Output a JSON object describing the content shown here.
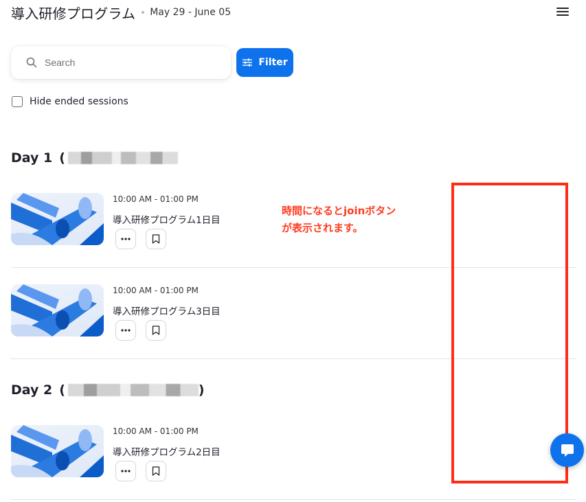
{
  "header": {
    "title": "導入研修プログラム",
    "dates": "May 29 - June 05"
  },
  "search": {
    "placeholder": "Search"
  },
  "filter": {
    "label": "Filter"
  },
  "hide_ended": {
    "label": "Hide ended sessions",
    "checked": false
  },
  "days": [
    {
      "label": "Day 1",
      "open_paren": "("
    },
    {
      "label": "Day 2",
      "open_paren": "(",
      "close_paren": ")"
    }
  ],
  "sessions": [
    {
      "time": "10:00 AM - 01:00 PM",
      "name": "導入研修プログラム1日目"
    },
    {
      "time": "10:00 AM - 01:00 PM",
      "name": "導入研修プログラム3日目"
    },
    {
      "time": "10:00 AM - 01:00 PM",
      "name": "導入研修プログラム2日目"
    }
  ],
  "annotation": {
    "line1": "時間になるとjoinボタン",
    "line2": "が表示されます。"
  },
  "colors": {
    "accent": "#0e72ed",
    "annotation": "#ff2d16"
  },
  "icons": {
    "menu": "hamburger-icon",
    "search": "search-icon",
    "filter": "sliders-icon",
    "more": "ellipsis-icon",
    "bookmark": "bookmark-icon",
    "chat": "chat-icon"
  }
}
